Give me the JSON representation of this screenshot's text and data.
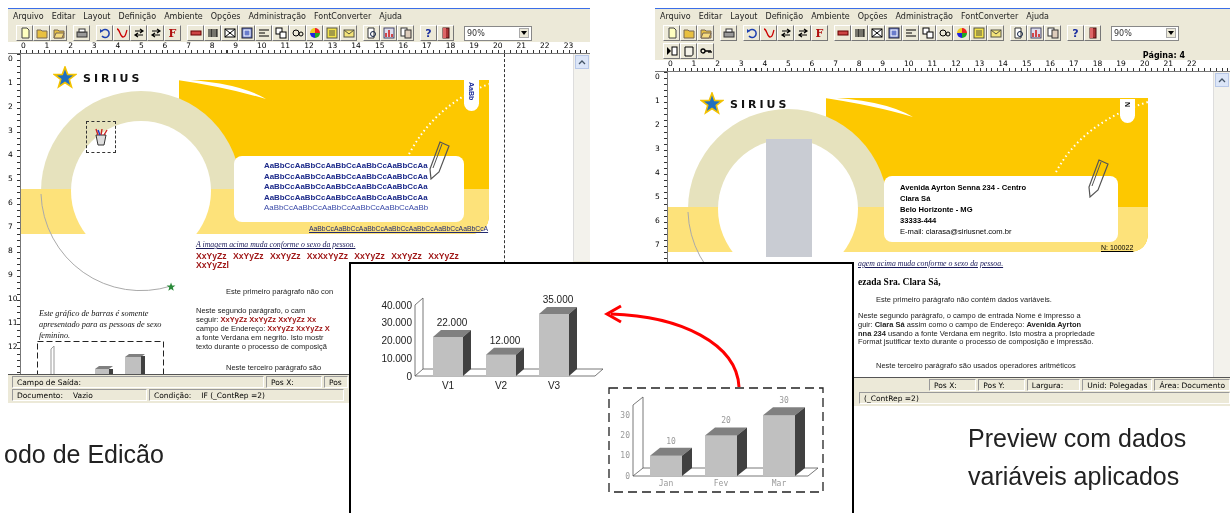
{
  "windows": [
    {
      "kind": "editor",
      "menu": [
        "Arquivo",
        "Editar",
        "Layout",
        "Definição",
        "Ambiente",
        "Opções",
        "Administração",
        "FontConverter",
        "Ajuda"
      ],
      "toolbar": {
        "letter_button": "F",
        "help_button": "?",
        "zoom": "90%"
      },
      "ruler_h": [
        "0",
        "1",
        "2",
        "3",
        "4",
        "5",
        "6",
        "7",
        "8",
        "9",
        "10",
        "11",
        "12",
        "13",
        "14",
        "15",
        "16",
        "17",
        "18",
        "19",
        "20",
        "21",
        "22",
        "23"
      ],
      "ruler_v": [
        "0",
        "1",
        "2",
        "3",
        "4",
        "5",
        "6",
        "7",
        "8",
        "9",
        "10",
        "11",
        "12"
      ],
      "document": {
        "logo": "SIRIUS",
        "corner_tag": "AaBb",
        "sample_lines": [
          "AaBbCcAaBbCcAaBbCcAaBbCcAaBbCcAa",
          "AaBbCcAaBbCcAaBbCcAaBbCcAaBbCcAa",
          "AaBbCcAaBbCcAaBbCcAaBbCcAaBbCcAa",
          "AaBbCcAaBbCcAaBbCcAaBbCcAaBbCcAa",
          "AaBbCcAaBbCcAaBbCcAaBbCcAaBbCcAaBb"
        ],
        "sample_link": "AaBbCcAaBbCcAaBbCcAaBbCcAaBbCcAaBbCcAaBbCcA",
        "image_note": "A imagem acima muda conforme o sexo da pessoa.",
        "variable_lines": [
          "XxYyZz XxYyZz XxYyZz XxXxYyZz XxYyZz XxYyZz XxYyZz",
          "XxYyZzl"
        ],
        "paragraphs": [
          [
            "Este primeiro parágrafo não con"
          ],
          [
            "Neste segundo parágrafo, o cam",
            "seguir: **XxYyZz XxYyZz XxYyZz Xx**",
            "campo de Endereço: **XxYyZz XxYyZz X**",
            "a fonte Verdana em negrito. Isto mostr",
            "texto durante o processo de composiçã"
          ],
          [
            "Neste terceiro parágrafo são"
          ]
        ],
        "chart_note": "Este gráfico de barras é somente apresentado para as pessoas de sexo feminino."
      },
      "status_rows": [
        [
          [
            "Campo de Saída:"
          ],
          [
            "Pos X:"
          ],
          [
            "Pos"
          ]
        ],
        [
          [
            "Documento:",
            "Vazio"
          ],
          [
            "Condição:",
            "IF (_ContRep =2)"
          ]
        ]
      ],
      "caption": "odo de Edicão"
    },
    {
      "kind": "preview",
      "menu": [
        "Arquivo",
        "Editar",
        "Layout",
        "Definição",
        "Ambiente",
        "Opções",
        "Administração",
        "FontConverter",
        "Ajuda"
      ],
      "toolbar": {
        "letter_button": "F",
        "help_button": "?",
        "zoom": "90%",
        "page_label": "Página: 4"
      },
      "ruler_h": [
        "0",
        "1",
        "2",
        "3",
        "4",
        "5",
        "6",
        "7",
        "8",
        "9",
        "10",
        "11",
        "12",
        "13",
        "14",
        "15",
        "16",
        "17",
        "18",
        "19",
        "20",
        "21",
        "22"
      ],
      "ruler_v": [
        "0",
        "1",
        "2",
        "3",
        "4",
        "5",
        "6",
        "7"
      ],
      "document": {
        "logo": "SIRIUS",
        "corner_tag": "N",
        "address_lines": [
          "Avenida Ayrton Senna 234 - Centro",
          "Clara Sá",
          "Belo Horizonte - MG",
          "33333-444",
          "E-mail: clarasa@siriusnet.com.br"
        ],
        "record_number": "N: 100022",
        "image_note": "agem acima muda conforme o sexo da pessoa.",
        "greeting": "ezada Sra. Clara Sá,",
        "paragraphs": [
          [
            "Este primeiro parágrafo não contém dados variáveis."
          ],
          [
            "Neste segundo parágrafo, o campo de entrada Nome é impresso a",
            "guir: **Clara Sá** assim como o campo de Endereço: **Avenida Ayrton**",
            "**nna 234** usando a fonte Verdana em negrito. Isto mostra a propriedade",
            "Format jsutificar texto durante o processo de composição e impressão."
          ],
          [
            "Neste terceiro parágrafo são usados operadores aritméticos"
          ]
        ]
      },
      "status_rows": [
        [
          [
            "Pos X:"
          ],
          [
            "Pos Y:"
          ],
          [
            "Largura:"
          ],
          [
            "Unid: Polegadas"
          ],
          [
            "Área: Documento"
          ]
        ],
        [
          [
            "(_ContRep =2)"
          ]
        ]
      ],
      "caption": "Preview com dados variáveis aplicados"
    }
  ],
  "inset": {
    "charts": [
      {
        "chart_data": {
          "type": "bar",
          "categories": [
            "V1",
            "V2",
            "V3"
          ],
          "series": [
            {
              "color": "#c0c0c0",
              "values": [
                22000,
                12000,
                35000
              ]
            }
          ],
          "ylim": [
            0,
            40000
          ],
          "yticks": [
            {
              "value": 0,
              "label": "0"
            },
            {
              "value": 10000,
              "label": "10.000"
            },
            {
              "value": 20000,
              "label": "20.000"
            },
            {
              "value": 30000,
              "label": "30.000"
            },
            {
              "value": 40000,
              "label": "40.000"
            }
          ],
          "value_labels": [
            "22.000",
            "12.000",
            "35.000"
          ]
        }
      },
      {
        "chart_data": {
          "type": "bar",
          "categories": [
            "Jan",
            "Fev",
            "Mar"
          ],
          "series": [
            {
              "color": "#c0c0c0",
              "values": [
                10,
                20,
                30
              ]
            }
          ],
          "ylim": [
            0,
            35
          ],
          "yticks": [
            0,
            10,
            20,
            30
          ],
          "value_labels": [
            "10",
            "20",
            "30"
          ]
        }
      }
    ]
  }
}
